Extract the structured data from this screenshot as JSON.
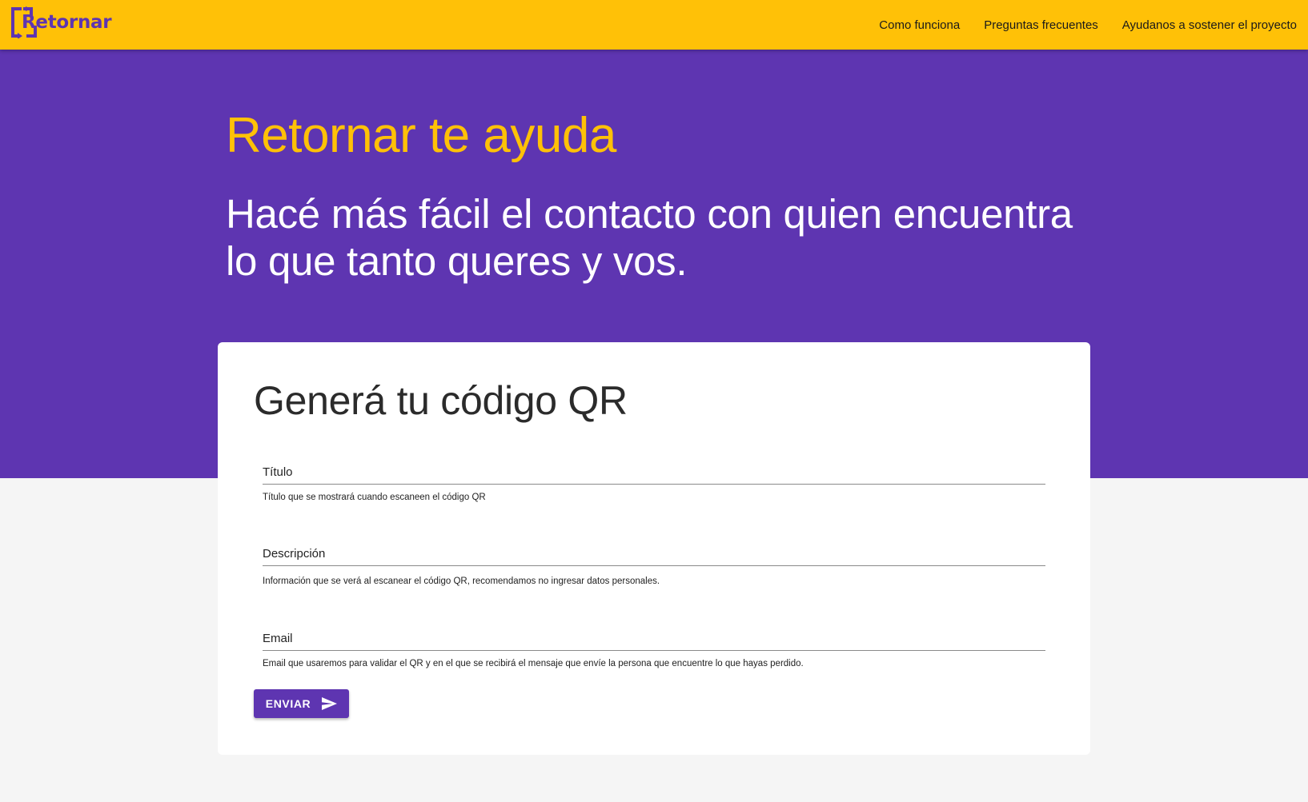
{
  "brand": {
    "name": "Retornar",
    "primary_color": "#5e35b1",
    "accent_color": "#ffc107"
  },
  "nav": {
    "items": [
      {
        "label": "Como funciona"
      },
      {
        "label": "Preguntas frecuentes"
      },
      {
        "label": "Ayudanos a sostener el proyecto"
      }
    ]
  },
  "hero": {
    "title": "Retornar te ayuda",
    "subtitle": "Hacé más fácil el contacto con quien encuentra lo que tanto queres y vos."
  },
  "form": {
    "title": "Generá tu código QR",
    "fields": [
      {
        "label": "Título",
        "value": "",
        "help": "Título que se mostrará cuando escaneen el código QR"
      },
      {
        "label": "Descripción",
        "value": "",
        "help": "Información que se verá al escanear el código QR, recomendamos no ingresar datos personales."
      },
      {
        "label": "Email",
        "value": "",
        "help": "Email que usaremos para validar el QR y en el que se recibirá el mensaje que envíe la persona que encuentre lo que hayas perdido."
      }
    ],
    "submit_label": "ENVIAR",
    "submit_icon": "send-icon"
  }
}
